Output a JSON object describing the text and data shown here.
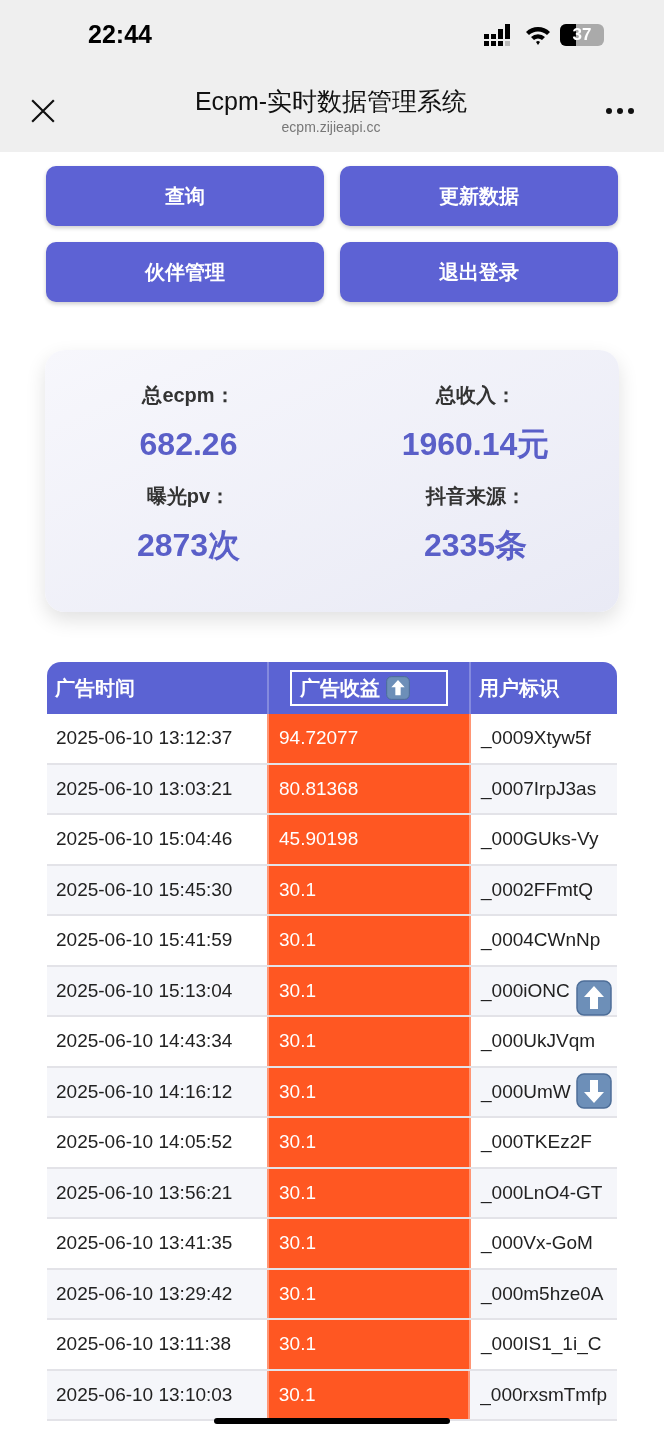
{
  "status_bar": {
    "time": "22:44",
    "battery": "37"
  },
  "nav": {
    "title": "Ecpm-实时数据管理系统",
    "subtitle": "ecpm.zijieapi.cc"
  },
  "buttons": [
    "查询",
    "更新数据",
    "伙伴管理",
    "退出登录"
  ],
  "stats": [
    {
      "label": "总ecpm：",
      "value": "682.26"
    },
    {
      "label": "总收入：",
      "value": "1960.14元"
    },
    {
      "label": "曝光pv：",
      "value": "2873次"
    },
    {
      "label": "抖音来源：",
      "value": "2335条"
    }
  ],
  "table": {
    "columns": [
      {
        "label": "广告时间",
        "sorted": false
      },
      {
        "label": "广告收益",
        "sorted": true
      },
      {
        "label": "用户标识",
        "sorted": false
      }
    ],
    "rows": [
      {
        "time": "2025-06-10 13:12:37",
        "revenue": "94.72077",
        "user": "_0009Xtyw5f"
      },
      {
        "time": "2025-06-10 13:03:21",
        "revenue": "80.81368",
        "user": "_0007IrpJ3as"
      },
      {
        "time": "2025-06-10 15:04:46",
        "revenue": "45.90198",
        "user": "_000GUks-Vy"
      },
      {
        "time": "2025-06-10 15:45:30",
        "revenue": "30.1",
        "user": "_0002FFmtQ"
      },
      {
        "time": "2025-06-10 15:41:59",
        "revenue": "30.1",
        "user": "_0004CWnNp"
      },
      {
        "time": "2025-06-10 15:13:04",
        "revenue": "30.1",
        "user": "_000iONC"
      },
      {
        "time": "2025-06-10 14:43:34",
        "revenue": "30.1",
        "user": "_000UkJVqm"
      },
      {
        "time": "2025-06-10 14:16:12",
        "revenue": "30.1",
        "user": "_000UmW"
      },
      {
        "time": "2025-06-10 14:05:52",
        "revenue": "30.1",
        "user": "_000TKEz2F"
      },
      {
        "time": "2025-06-10 13:56:21",
        "revenue": "30.1",
        "user": "_000LnO4-GT"
      },
      {
        "time": "2025-06-10 13:41:35",
        "revenue": "30.1",
        "user": "_000Vx-GoM"
      },
      {
        "time": "2025-06-10 13:29:42",
        "revenue": "30.1",
        "user": "_000m5hze0A"
      },
      {
        "time": "2025-06-10 13:11:38",
        "revenue": "30.1",
        "user": "_000IS1_1i_C"
      },
      {
        "time": "2025-06-10 13:10:03",
        "revenue": "30.1",
        "user": "_000rxsmTmfp"
      }
    ]
  }
}
